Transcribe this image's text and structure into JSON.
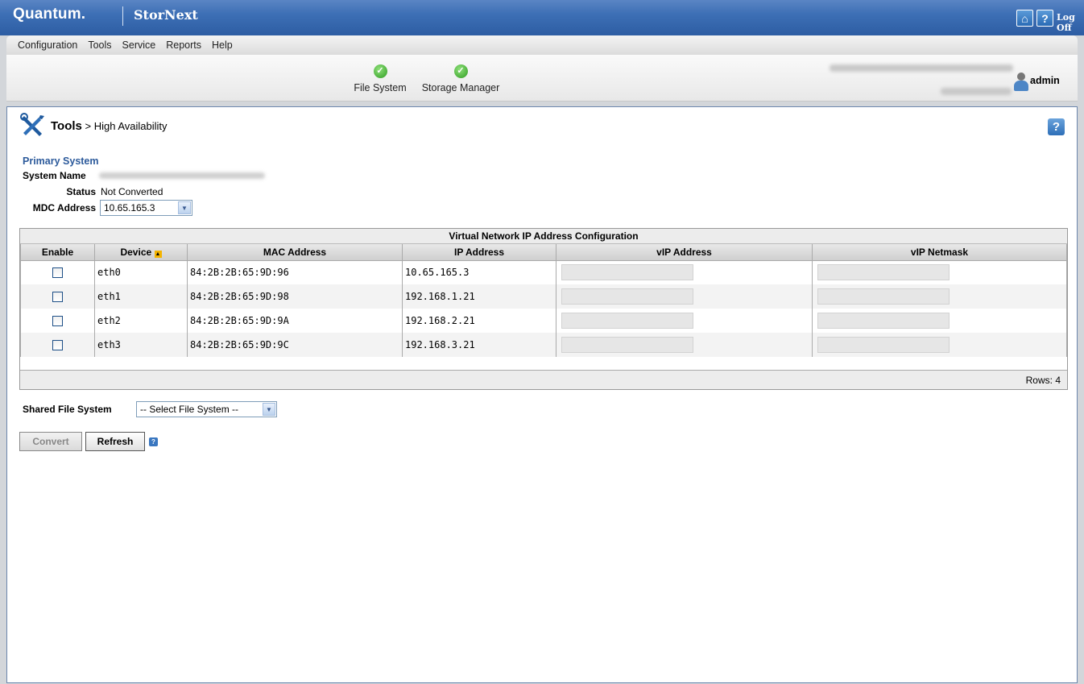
{
  "header": {
    "logo": "Quantum.",
    "product": "StorNext",
    "logoff": "Log Off"
  },
  "menu": [
    "Configuration",
    "Tools",
    "Service",
    "Reports",
    "Help"
  ],
  "status": {
    "file_system": "File System",
    "storage_manager": "Storage Manager",
    "user": "admin"
  },
  "page": {
    "section": "Tools",
    "breadcrumb_rest": " > High Availability"
  },
  "primary": {
    "title": "Primary System",
    "system_name_label": "System Name",
    "status_label": "Status",
    "status_value": "Not Converted",
    "mdc_label": "MDC Address",
    "mdc_value": "10.65.165.3"
  },
  "grid": {
    "caption": "Virtual Network IP Address Configuration",
    "columns": [
      "Enable",
      "Device",
      "MAC Address",
      "IP Address",
      "vIP Address",
      "vIP Netmask"
    ],
    "rows": [
      {
        "device": "eth0",
        "mac": "84:2B:2B:65:9D:96",
        "ip": "10.65.165.3"
      },
      {
        "device": "eth1",
        "mac": "84:2B:2B:65:9D:98",
        "ip": "192.168.1.21"
      },
      {
        "device": "eth2",
        "mac": "84:2B:2B:65:9D:9A",
        "ip": "192.168.2.21"
      },
      {
        "device": "eth3",
        "mac": "84:2B:2B:65:9D:9C",
        "ip": "192.168.3.21"
      }
    ],
    "footer": "Rows: 4"
  },
  "shared": {
    "label": "Shared File System",
    "value": "-- Select File System --"
  },
  "buttons": {
    "convert": "Convert",
    "refresh": "Refresh"
  }
}
